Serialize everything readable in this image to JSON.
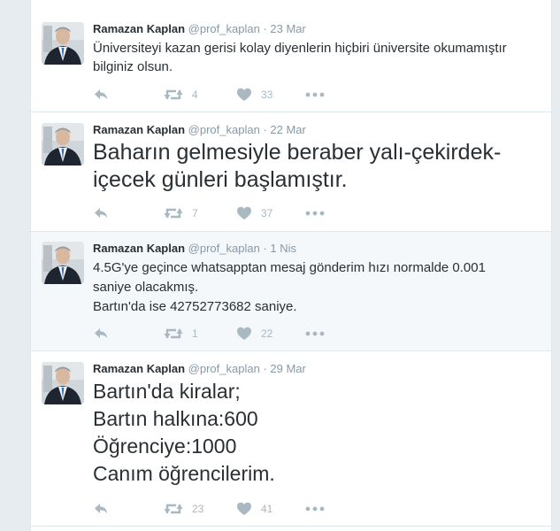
{
  "colors": {
    "page_bg": "#e6ecf0",
    "card_bg": "#ffffff",
    "divider": "#e1e8ed",
    "icon_gray": "#aab8c2",
    "meta_gray": "#8899a6"
  },
  "icons": {
    "reply": "reply-icon",
    "retweet": "retweet-icon",
    "like": "heart-icon",
    "more": "more-icon"
  },
  "tweets": [
    {
      "name": "Ramazan Kaplan",
      "handle": "@prof_kaplan",
      "dot": "·",
      "time": "23 Mar",
      "lines": [
        "Üniversiteyi kazan gerisi kolay diyenlerin hiçbiri üniversite okumamıştır",
        "bilginiz olsun."
      ],
      "retweets": "4",
      "likes": "33"
    },
    {
      "name": "Ramazan Kaplan",
      "handle": "@prof_kaplan",
      "dot": "·",
      "time": "22 Mar",
      "lines": [
        "Baharın gelmesiyle beraber yalı-çekirdek-",
        "içecek günleri başlamıştır."
      ],
      "retweets": "7",
      "likes": "37"
    },
    {
      "name": "Ramazan Kaplan",
      "handle": "@prof_kaplan",
      "dot": "·",
      "time": "1 Nis",
      "lines": [
        "4.5G'ye geçince whatsapptan mesaj gönderim hızı normalde 0.001",
        "saniye olacakmış.",
        "Bartın'da ise 42752773682 saniye."
      ],
      "retweets": "1",
      "likes": "22"
    },
    {
      "name": "Ramazan Kaplan",
      "handle": "@prof_kaplan",
      "dot": "·",
      "time": "29 Mar",
      "lines": [
        "Bartın'da kiralar;",
        "Bartın halkına:600",
        "Öğrenciye:1000",
        "Canım öğrencilerim."
      ],
      "retweets": "23",
      "likes": "41"
    }
  ]
}
